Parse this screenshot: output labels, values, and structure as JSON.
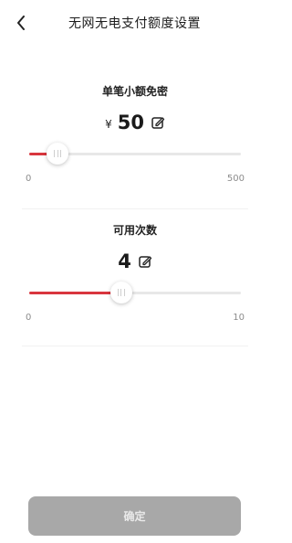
{
  "header": {
    "title": "无网无电支付额度设置",
    "back_icon": "chevron-left-icon"
  },
  "limit": {
    "title": "单笔小额免密",
    "currency": "¥",
    "value": "50",
    "edit_icon": "edit-pencil-icon",
    "min_label": "0",
    "max_label": "500",
    "level_fraction": 0.1
  },
  "count": {
    "title": "可用次数",
    "value": "4",
    "edit_icon": "edit-pencil-icon",
    "min_label": "0",
    "max_label": "10",
    "level_fraction": 0.4
  },
  "footer": {
    "confirm_label": "确定"
  },
  "colors": {
    "accent": "#d9363e",
    "track": "#e8e8e8",
    "button_disabled": "#a8a8a8"
  }
}
